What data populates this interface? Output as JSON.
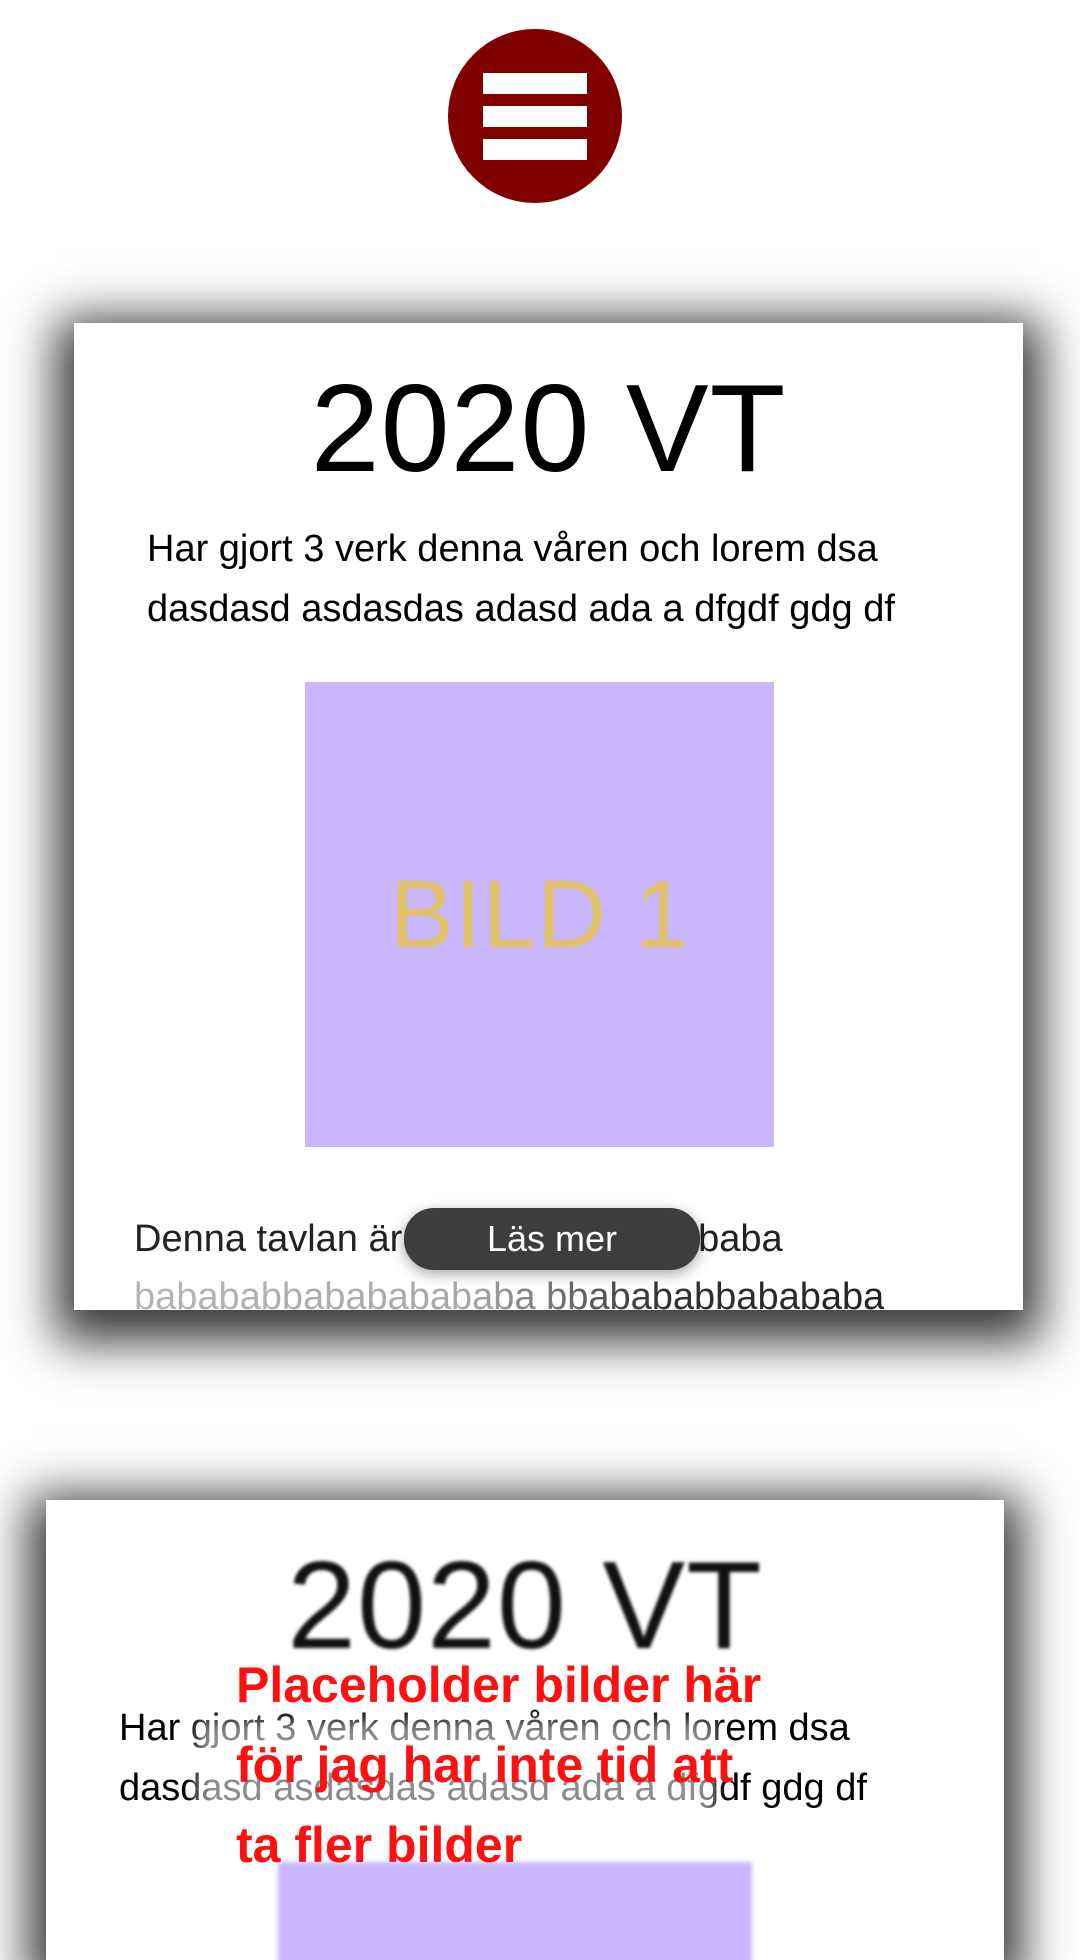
{
  "menu": {
    "icon": "hamburger-menu-icon",
    "color": "#800000"
  },
  "cards": [
    {
      "title": "2020 VT",
      "description_lines": [
        "Har gjort 3 verk denna våren och lorem dsa",
        "dasdasd asdasdas adasd ada a dfgdf gdg df"
      ],
      "image_label": "BILD 1",
      "image_color": "#c9b6fd",
      "body_lines": [
        "Denna tavlan är en bababababbababa",
        "babababbabababababa bbabababbabababa"
      ],
      "read_more_label": "Läs mer"
    },
    {
      "title": "2020 VT",
      "description_lines": [
        "Har gjort 3 verk denna våren och lorem dsa",
        "dasdasd asdasdas adasd ada a dfgdf gdg df"
      ],
      "image_color": "#c9b6fd"
    }
  ],
  "placeholder_note": {
    "lines": [
      "Placeholder bilder här",
      "för jag har inte tid att",
      "ta fler bilder"
    ],
    "color": "#ff1010"
  }
}
